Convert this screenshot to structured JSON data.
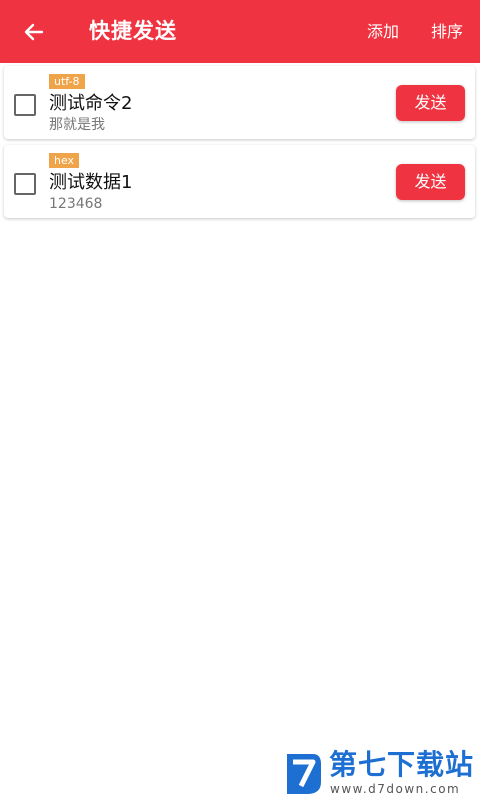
{
  "appbar": {
    "title": "快捷发送",
    "actions": {
      "add": "添加",
      "sort": "排序"
    }
  },
  "items": [
    {
      "encoding": "utf-8",
      "name": "测试命令2",
      "content": "那就是我",
      "send_label": "发送",
      "checked": false
    },
    {
      "encoding": "hex",
      "name": "测试数据1",
      "content": "123468",
      "send_label": "发送",
      "checked": false
    }
  ],
  "watermark": {
    "title": "第七下载站",
    "url": "www.d7down.com"
  },
  "colors": {
    "primary": "#ef3340",
    "badge": "#f0a44a",
    "watermark": "#1d6fd1"
  }
}
